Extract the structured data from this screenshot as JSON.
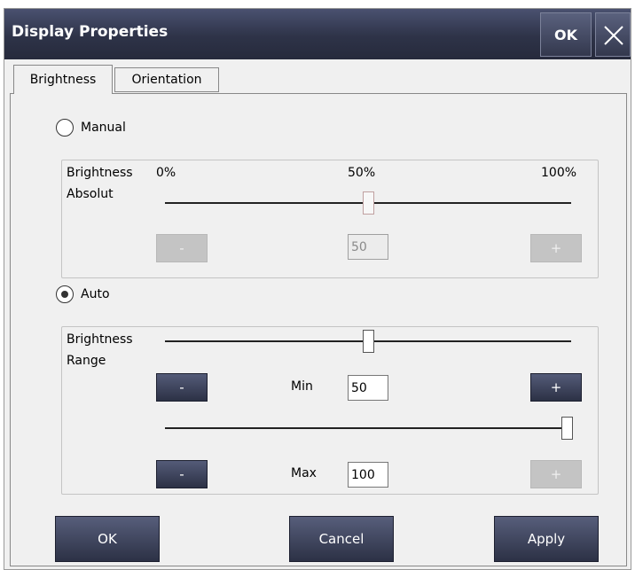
{
  "window": {
    "title": "Display Properties",
    "ok_label": "OK",
    "close_icon": "close-icon"
  },
  "tabs": [
    {
      "label": "Brightness",
      "active": true
    },
    {
      "label": "Orientation",
      "active": false
    }
  ],
  "manual": {
    "radio_label": "Manual",
    "selected": false,
    "group_label_line1": "Brightness",
    "group_label_line2": "Absolut",
    "scale_min": "0%",
    "scale_mid": "50%",
    "scale_max": "100%",
    "slider_value_pct": 50,
    "minus_label": "-",
    "plus_label": "+",
    "value": "50",
    "enabled": false
  },
  "auto": {
    "radio_label": "Auto",
    "selected": true,
    "group_label_line1": "Brightness",
    "group_label_line2": "Range",
    "min_label": "Min",
    "min_value": "50",
    "max_label": "Max",
    "max_value": "100",
    "minus_label": "-",
    "plus_label": "+",
    "min_slider_pct": 50,
    "max_slider_pct": 100
  },
  "footer": {
    "ok_label": "OK",
    "cancel_label": "Cancel",
    "apply_label": "Apply"
  }
}
